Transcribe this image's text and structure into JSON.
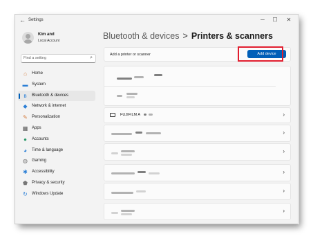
{
  "window": {
    "title": "Settings",
    "back_glyph": "←",
    "controls": {
      "minimize": "─",
      "maximize": "☐",
      "close": "✕"
    }
  },
  "user": {
    "name": "Kim and",
    "account_type": "Local Account"
  },
  "search": {
    "placeholder": "Find a setting",
    "icon": "search-icon"
  },
  "nav": {
    "items": [
      {
        "label": "Home",
        "icon": "home-icon",
        "glyph": "⌂",
        "color": "#d47a3a"
      },
      {
        "label": "System",
        "icon": "system-icon",
        "glyph": "▬",
        "color": "#2b7fd6"
      },
      {
        "label": "Bluetooth & devices",
        "icon": "bluetooth-icon",
        "glyph": "ʙ",
        "color": "#2b7fd6",
        "active": true
      },
      {
        "label": "Network & internet",
        "icon": "network-icon",
        "glyph": "◆",
        "color": "#2b7fd6"
      },
      {
        "label": "Personalization",
        "icon": "brush-icon",
        "glyph": "✎",
        "color": "#d47a3a"
      },
      {
        "label": "Apps",
        "icon": "apps-icon",
        "glyph": "▦",
        "color": "#555555"
      },
      {
        "label": "Accounts",
        "icon": "accounts-icon",
        "glyph": "●",
        "color": "#2b9a6a"
      },
      {
        "label": "Time & language",
        "icon": "globe-icon",
        "glyph": "◕",
        "color": "#2b7fd6"
      },
      {
        "label": "Gaming",
        "icon": "gaming-icon",
        "glyph": "◍",
        "color": "#777777"
      },
      {
        "label": "Accessibility",
        "icon": "accessibility-icon",
        "glyph": "✱",
        "color": "#2b7fd6"
      },
      {
        "label": "Privacy & security",
        "icon": "shield-icon",
        "glyph": "⬟",
        "color": "#777777"
      },
      {
        "label": "Windows Update",
        "icon": "update-icon",
        "glyph": "↻",
        "color": "#2b7fd6"
      }
    ]
  },
  "header": {
    "parent": "Bluetooth & devices",
    "separator": ">",
    "current": "Printers & scanners"
  },
  "add_printer": {
    "label": "Add a printer or scanner",
    "button": "Add device"
  },
  "printers": {
    "named": "FUJIFILM A",
    "chevron": "›"
  },
  "colors": {
    "accent": "#005fb8",
    "highlight": "#e11d2e"
  }
}
